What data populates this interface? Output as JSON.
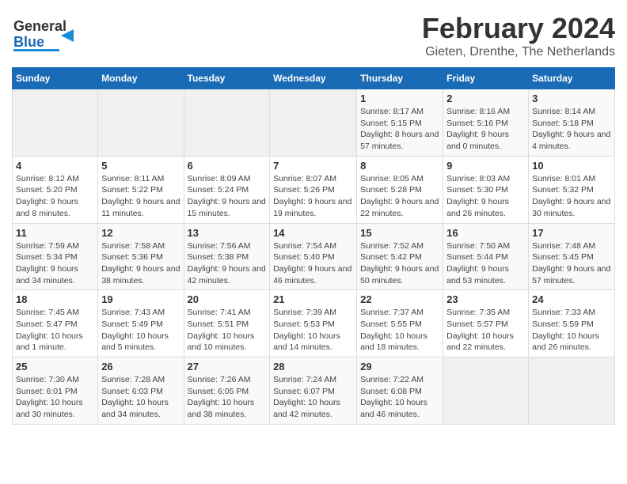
{
  "header": {
    "logo_general": "General",
    "logo_blue": "Blue",
    "month": "February 2024",
    "location": "Gieten, Drenthe, The Netherlands"
  },
  "days_of_week": [
    "Sunday",
    "Monday",
    "Tuesday",
    "Wednesday",
    "Thursday",
    "Friday",
    "Saturday"
  ],
  "weeks": [
    [
      {
        "day": "",
        "sunrise": "",
        "sunset": "",
        "daylight": ""
      },
      {
        "day": "",
        "sunrise": "",
        "sunset": "",
        "daylight": ""
      },
      {
        "day": "",
        "sunrise": "",
        "sunset": "",
        "daylight": ""
      },
      {
        "day": "",
        "sunrise": "",
        "sunset": "",
        "daylight": ""
      },
      {
        "day": "1",
        "sunrise": "Sunrise: 8:17 AM",
        "sunset": "Sunset: 5:15 PM",
        "daylight": "Daylight: 8 hours and 57 minutes."
      },
      {
        "day": "2",
        "sunrise": "Sunrise: 8:16 AM",
        "sunset": "Sunset: 5:16 PM",
        "daylight": "Daylight: 9 hours and 0 minutes."
      },
      {
        "day": "3",
        "sunrise": "Sunrise: 8:14 AM",
        "sunset": "Sunset: 5:18 PM",
        "daylight": "Daylight: 9 hours and 4 minutes."
      }
    ],
    [
      {
        "day": "4",
        "sunrise": "Sunrise: 8:12 AM",
        "sunset": "Sunset: 5:20 PM",
        "daylight": "Daylight: 9 hours and 8 minutes."
      },
      {
        "day": "5",
        "sunrise": "Sunrise: 8:11 AM",
        "sunset": "Sunset: 5:22 PM",
        "daylight": "Daylight: 9 hours and 11 minutes."
      },
      {
        "day": "6",
        "sunrise": "Sunrise: 8:09 AM",
        "sunset": "Sunset: 5:24 PM",
        "daylight": "Daylight: 9 hours and 15 minutes."
      },
      {
        "day": "7",
        "sunrise": "Sunrise: 8:07 AM",
        "sunset": "Sunset: 5:26 PM",
        "daylight": "Daylight: 9 hours and 19 minutes."
      },
      {
        "day": "8",
        "sunrise": "Sunrise: 8:05 AM",
        "sunset": "Sunset: 5:28 PM",
        "daylight": "Daylight: 9 hours and 22 minutes."
      },
      {
        "day": "9",
        "sunrise": "Sunrise: 8:03 AM",
        "sunset": "Sunset: 5:30 PM",
        "daylight": "Daylight: 9 hours and 26 minutes."
      },
      {
        "day": "10",
        "sunrise": "Sunrise: 8:01 AM",
        "sunset": "Sunset: 5:32 PM",
        "daylight": "Daylight: 9 hours and 30 minutes."
      }
    ],
    [
      {
        "day": "11",
        "sunrise": "Sunrise: 7:59 AM",
        "sunset": "Sunset: 5:34 PM",
        "daylight": "Daylight: 9 hours and 34 minutes."
      },
      {
        "day": "12",
        "sunrise": "Sunrise: 7:58 AM",
        "sunset": "Sunset: 5:36 PM",
        "daylight": "Daylight: 9 hours and 38 minutes."
      },
      {
        "day": "13",
        "sunrise": "Sunrise: 7:56 AM",
        "sunset": "Sunset: 5:38 PM",
        "daylight": "Daylight: 9 hours and 42 minutes."
      },
      {
        "day": "14",
        "sunrise": "Sunrise: 7:54 AM",
        "sunset": "Sunset: 5:40 PM",
        "daylight": "Daylight: 9 hours and 46 minutes."
      },
      {
        "day": "15",
        "sunrise": "Sunrise: 7:52 AM",
        "sunset": "Sunset: 5:42 PM",
        "daylight": "Daylight: 9 hours and 50 minutes."
      },
      {
        "day": "16",
        "sunrise": "Sunrise: 7:50 AM",
        "sunset": "Sunset: 5:44 PM",
        "daylight": "Daylight: 9 hours and 53 minutes."
      },
      {
        "day": "17",
        "sunrise": "Sunrise: 7:48 AM",
        "sunset": "Sunset: 5:45 PM",
        "daylight": "Daylight: 9 hours and 57 minutes."
      }
    ],
    [
      {
        "day": "18",
        "sunrise": "Sunrise: 7:45 AM",
        "sunset": "Sunset: 5:47 PM",
        "daylight": "Daylight: 10 hours and 1 minute."
      },
      {
        "day": "19",
        "sunrise": "Sunrise: 7:43 AM",
        "sunset": "Sunset: 5:49 PM",
        "daylight": "Daylight: 10 hours and 5 minutes."
      },
      {
        "day": "20",
        "sunrise": "Sunrise: 7:41 AM",
        "sunset": "Sunset: 5:51 PM",
        "daylight": "Daylight: 10 hours and 10 minutes."
      },
      {
        "day": "21",
        "sunrise": "Sunrise: 7:39 AM",
        "sunset": "Sunset: 5:53 PM",
        "daylight": "Daylight: 10 hours and 14 minutes."
      },
      {
        "day": "22",
        "sunrise": "Sunrise: 7:37 AM",
        "sunset": "Sunset: 5:55 PM",
        "daylight": "Daylight: 10 hours and 18 minutes."
      },
      {
        "day": "23",
        "sunrise": "Sunrise: 7:35 AM",
        "sunset": "Sunset: 5:57 PM",
        "daylight": "Daylight: 10 hours and 22 minutes."
      },
      {
        "day": "24",
        "sunrise": "Sunrise: 7:33 AM",
        "sunset": "Sunset: 5:59 PM",
        "daylight": "Daylight: 10 hours and 26 minutes."
      }
    ],
    [
      {
        "day": "25",
        "sunrise": "Sunrise: 7:30 AM",
        "sunset": "Sunset: 6:01 PM",
        "daylight": "Daylight: 10 hours and 30 minutes."
      },
      {
        "day": "26",
        "sunrise": "Sunrise: 7:28 AM",
        "sunset": "Sunset: 6:03 PM",
        "daylight": "Daylight: 10 hours and 34 minutes."
      },
      {
        "day": "27",
        "sunrise": "Sunrise: 7:26 AM",
        "sunset": "Sunset: 6:05 PM",
        "daylight": "Daylight: 10 hours and 38 minutes."
      },
      {
        "day": "28",
        "sunrise": "Sunrise: 7:24 AM",
        "sunset": "Sunset: 6:07 PM",
        "daylight": "Daylight: 10 hours and 42 minutes."
      },
      {
        "day": "29",
        "sunrise": "Sunrise: 7:22 AM",
        "sunset": "Sunset: 6:08 PM",
        "daylight": "Daylight: 10 hours and 46 minutes."
      },
      {
        "day": "",
        "sunrise": "",
        "sunset": "",
        "daylight": ""
      },
      {
        "day": "",
        "sunrise": "",
        "sunset": "",
        "daylight": ""
      }
    ]
  ]
}
